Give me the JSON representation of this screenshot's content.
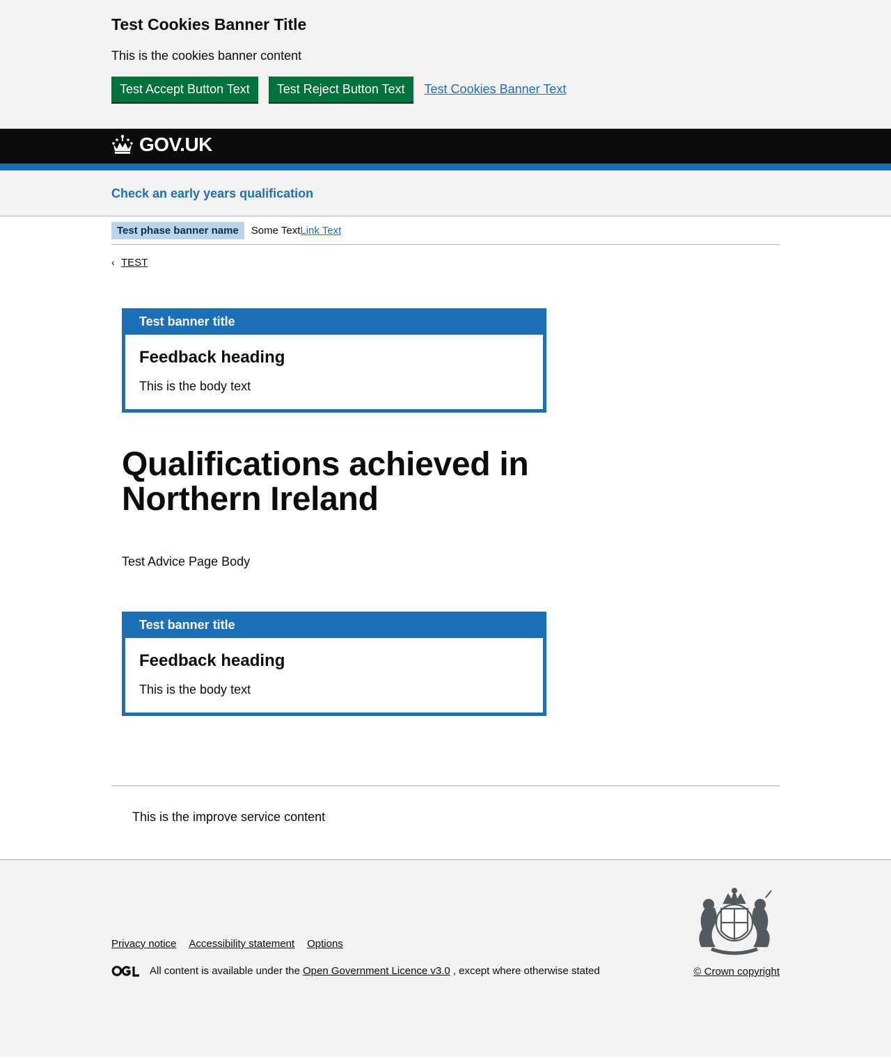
{
  "cookie_banner": {
    "title": "Test Cookies Banner Title",
    "content": "This is the cookies banner content",
    "accept_label": "Test Accept Button Text",
    "reject_label": "Test Reject Button Text",
    "link_label": "Test Cookies Banner Text"
  },
  "header": {
    "logo_text": "GOV.UK",
    "service_name": "Check an early years qualification"
  },
  "phase_banner": {
    "tag": "Test phase banner name",
    "text": "Some Text",
    "link": "Link Text"
  },
  "back_link": "TEST",
  "feedback_banner_top": {
    "title": "Test banner title",
    "heading": "Feedback heading",
    "body": "This is the body text"
  },
  "main": {
    "title": "Qualifications achieved in Northern Ireland",
    "body": "Test Advice Page Body"
  },
  "feedback_banner_bottom": {
    "title": "Test banner title",
    "heading": "Feedback heading",
    "body": "This is the body text"
  },
  "improve_service": "This is the improve service content",
  "footer": {
    "links": [
      "Privacy notice",
      "Accessibility statement",
      "Options"
    ],
    "licence_prefix": "All content is available under the",
    "licence_link": "Open Government Licence v3.0",
    "licence_suffix": ", except where otherwise stated",
    "copyright": "© Crown copyright"
  },
  "colors": {
    "button_green": "#00703c",
    "brand_blue": "#1d70b8",
    "header_black": "#0b0c0c",
    "light_grey": "#f3f2f1"
  }
}
